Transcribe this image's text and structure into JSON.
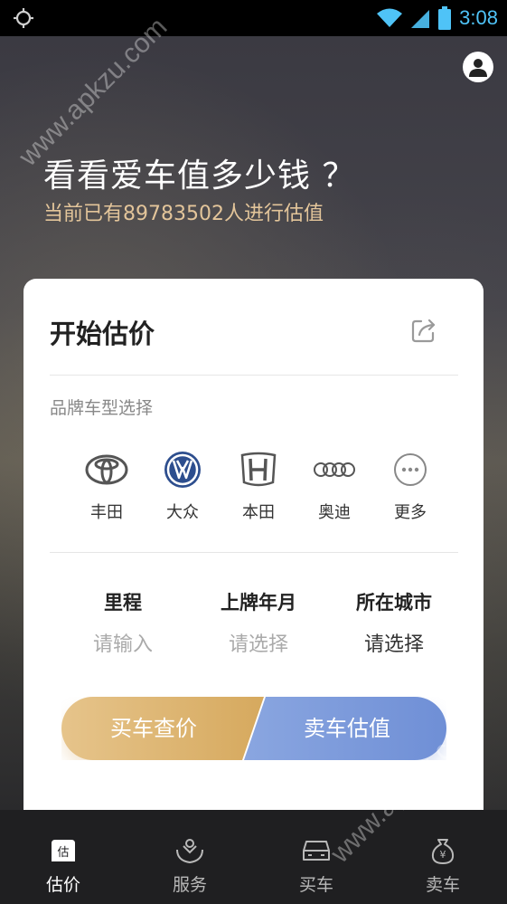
{
  "status_bar": {
    "time": "3:08"
  },
  "header": {
    "title": "看看爱车值多少钱 ？",
    "subtitle": "当前已有89783502人进行估值"
  },
  "card": {
    "title": "开始估价",
    "brand_section_label": "品牌车型选择",
    "brands": [
      {
        "name": "丰田",
        "icon": "toyota-logo"
      },
      {
        "name": "大众",
        "icon": "volkswagen-logo"
      },
      {
        "name": "本田",
        "icon": "honda-logo"
      },
      {
        "name": "奥迪",
        "icon": "audi-logo"
      },
      {
        "name": "更多",
        "icon": "more-icon"
      }
    ],
    "fields": [
      {
        "label": "里程",
        "value": "请输入"
      },
      {
        "label": "上牌年月",
        "value": "请选择"
      },
      {
        "label": "所在城市",
        "value": "请选择"
      }
    ],
    "buy_button": "买车查价",
    "sell_button": "卖车估值"
  },
  "tabs": [
    {
      "label": "估价",
      "icon": "valuation-icon",
      "active": true
    },
    {
      "label": "服务",
      "icon": "service-icon",
      "active": false
    },
    {
      "label": "买车",
      "icon": "car-icon",
      "active": false
    },
    {
      "label": "卖车",
      "icon": "money-bag-icon",
      "active": false
    }
  ],
  "watermark": "www.apkzu.com",
  "colors": {
    "gold": "#d6a95e",
    "blue": "#6f8fd6",
    "status_blue": "#4fc3f7",
    "subtitle": "#e3c59a"
  }
}
